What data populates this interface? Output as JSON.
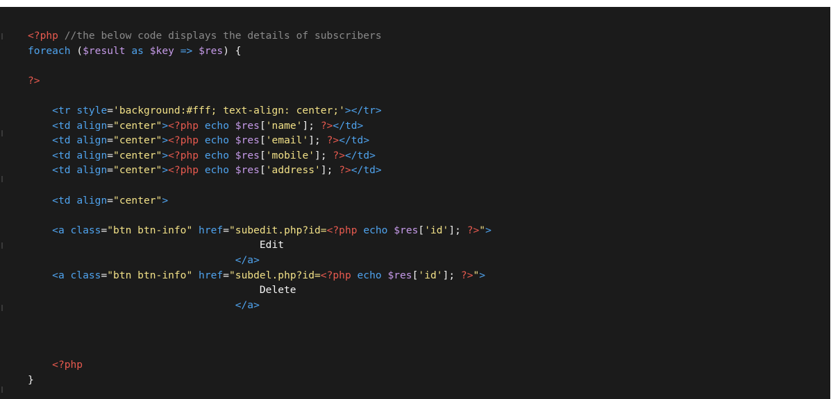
{
  "editor": {
    "theme_background": "#1b1b1b",
    "colors": {
      "php_delimiter": "#e85a4f",
      "comment": "#8a8a8a",
      "keyword": "#4fa3ee",
      "variable": "#c59ae8",
      "string": "#f1e087",
      "plain": "#f0f0f0"
    },
    "lines": [
      [
        [
          "php",
          "<?php"
        ],
        [
          "keyword",
          " "
        ],
        [
          "comment",
          "//the below code displays the details of subscribers"
        ]
      ],
      [
        [
          "keyword",
          "foreach"
        ],
        [
          "punct",
          " ("
        ],
        [
          "var",
          "$result"
        ],
        [
          "keyword",
          " as "
        ],
        [
          "var",
          "$key"
        ],
        [
          "keyword",
          " => "
        ],
        [
          "var",
          "$res"
        ],
        [
          "punct",
          ") {"
        ]
      ],
      [],
      [
        [
          "php",
          "?>"
        ]
      ],
      [],
      [
        [
          "plain",
          "    "
        ],
        [
          "tag",
          "<tr "
        ],
        [
          "attr",
          "style"
        ],
        [
          "punct",
          "="
        ],
        [
          "str",
          "'background:#fff; text-align: center;'"
        ],
        [
          "tag",
          "></tr>"
        ]
      ],
      [
        [
          "plain",
          "    "
        ],
        [
          "tag",
          "<td "
        ],
        [
          "attr",
          "align"
        ],
        [
          "punct",
          "="
        ],
        [
          "str",
          "\"center\""
        ],
        [
          "tag",
          ">"
        ],
        [
          "php",
          "<?php"
        ],
        [
          "keyword",
          " echo "
        ],
        [
          "var",
          "$res"
        ],
        [
          "punct",
          "["
        ],
        [
          "str",
          "'name'"
        ],
        [
          "punct",
          "]; "
        ],
        [
          "php",
          "?>"
        ],
        [
          "tag",
          "</td>"
        ]
      ],
      [
        [
          "plain",
          "    "
        ],
        [
          "tag",
          "<td "
        ],
        [
          "attr",
          "align"
        ],
        [
          "punct",
          "="
        ],
        [
          "str",
          "\"center\""
        ],
        [
          "tag",
          ">"
        ],
        [
          "php",
          "<?php"
        ],
        [
          "keyword",
          " echo "
        ],
        [
          "var",
          "$res"
        ],
        [
          "punct",
          "["
        ],
        [
          "str",
          "'email'"
        ],
        [
          "punct",
          "]; "
        ],
        [
          "php",
          "?>"
        ],
        [
          "tag",
          "</td>"
        ]
      ],
      [
        [
          "plain",
          "    "
        ],
        [
          "tag",
          "<td "
        ],
        [
          "attr",
          "align"
        ],
        [
          "punct",
          "="
        ],
        [
          "str",
          "\"center\""
        ],
        [
          "tag",
          ">"
        ],
        [
          "php",
          "<?php"
        ],
        [
          "keyword",
          " echo "
        ],
        [
          "var",
          "$res"
        ],
        [
          "punct",
          "["
        ],
        [
          "str",
          "'mobile'"
        ],
        [
          "punct",
          "]; "
        ],
        [
          "php",
          "?>"
        ],
        [
          "tag",
          "</td>"
        ]
      ],
      [
        [
          "plain",
          "    "
        ],
        [
          "tag",
          "<td "
        ],
        [
          "attr",
          "align"
        ],
        [
          "punct",
          "="
        ],
        [
          "str",
          "\"center\""
        ],
        [
          "tag",
          ">"
        ],
        [
          "php",
          "<?php"
        ],
        [
          "keyword",
          " echo "
        ],
        [
          "var",
          "$res"
        ],
        [
          "punct",
          "["
        ],
        [
          "str",
          "'address'"
        ],
        [
          "punct",
          "]; "
        ],
        [
          "php",
          "?>"
        ],
        [
          "tag",
          "</td>"
        ]
      ],
      [],
      [
        [
          "plain",
          "    "
        ],
        [
          "tag",
          "<td "
        ],
        [
          "attr",
          "align"
        ],
        [
          "punct",
          "="
        ],
        [
          "str",
          "\"center\""
        ],
        [
          "tag",
          ">"
        ]
      ],
      [],
      [
        [
          "plain",
          "    "
        ],
        [
          "tag",
          "<a "
        ],
        [
          "attr",
          "class"
        ],
        [
          "punct",
          "="
        ],
        [
          "str",
          "\"btn btn-info\""
        ],
        [
          "attr",
          " href"
        ],
        [
          "punct",
          "="
        ],
        [
          "str",
          "\"subedit.php?id="
        ],
        [
          "php",
          "<?php"
        ],
        [
          "keyword",
          " echo "
        ],
        [
          "var",
          "$res"
        ],
        [
          "punct",
          "["
        ],
        [
          "str",
          "'id'"
        ],
        [
          "punct",
          "]; "
        ],
        [
          "php",
          "?>"
        ],
        [
          "str",
          "\""
        ],
        [
          "tag",
          ">"
        ]
      ],
      [
        [
          "plain",
          "                                      Edit"
        ]
      ],
      [
        [
          "plain",
          "                                  "
        ],
        [
          "tag",
          "</a>"
        ]
      ],
      [
        [
          "plain",
          "    "
        ],
        [
          "tag",
          "<a "
        ],
        [
          "attr",
          "class"
        ],
        [
          "punct",
          "="
        ],
        [
          "str",
          "\"btn btn-info\""
        ],
        [
          "attr",
          " href"
        ],
        [
          "punct",
          "="
        ],
        [
          "str",
          "\"subdel.php?id="
        ],
        [
          "php",
          "<?php"
        ],
        [
          "keyword",
          " echo "
        ],
        [
          "var",
          "$res"
        ],
        [
          "punct",
          "["
        ],
        [
          "str",
          "'id'"
        ],
        [
          "punct",
          "]; "
        ],
        [
          "php",
          "?>"
        ],
        [
          "str",
          "\""
        ],
        [
          "tag",
          ">"
        ]
      ],
      [
        [
          "plain",
          "                                      Delete"
        ]
      ],
      [
        [
          "plain",
          "                                  "
        ],
        [
          "tag",
          "</a>"
        ]
      ],
      [],
      [],
      [],
      [
        [
          "plain",
          "    "
        ],
        [
          "php",
          "<?php"
        ]
      ],
      [
        [
          "punct",
          "}"
        ]
      ]
    ]
  }
}
